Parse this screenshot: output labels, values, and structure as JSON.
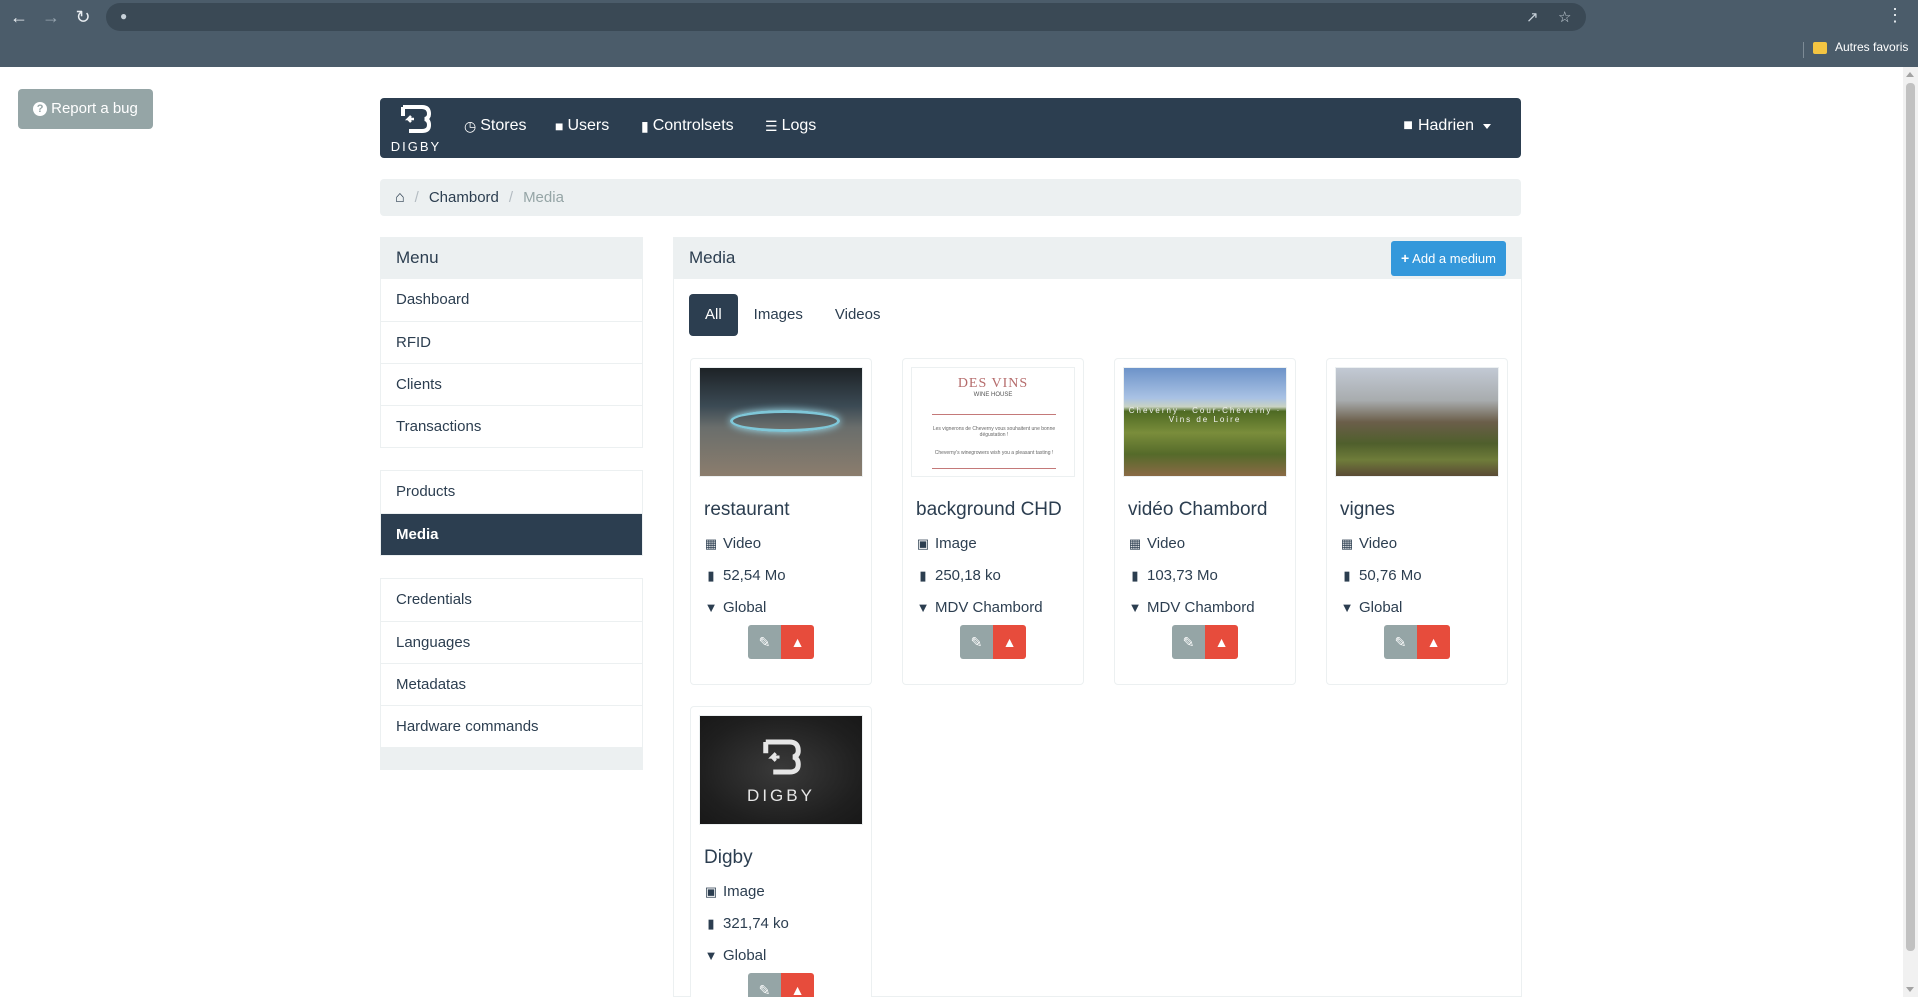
{
  "browser": {
    "bookmark_folder": "Autres favoris"
  },
  "report_bug": {
    "label": "Report a bug"
  },
  "navbar": {
    "brand": "DIGBY",
    "items": [
      {
        "label": "Stores",
        "icon": "dashboard-icon"
      },
      {
        "label": "Users",
        "icon": "user-icon"
      },
      {
        "label": "Controlsets",
        "icon": "signal-icon"
      },
      {
        "label": "Logs",
        "icon": "list-icon"
      }
    ],
    "user": "Hadrien"
  },
  "breadcrumb": {
    "items": [
      "Chambord",
      "Media"
    ]
  },
  "sidebar": {
    "title": "Menu",
    "group1": [
      "Dashboard",
      "RFID",
      "Clients",
      "Transactions"
    ],
    "group2": [
      "Products",
      "Media"
    ],
    "group3": [
      "Credentials",
      "Languages",
      "Metadatas",
      "Hardware commands"
    ],
    "active": "Media"
  },
  "media": {
    "title": "Media",
    "add_label": "Add a medium",
    "tabs": [
      "All",
      "Images",
      "Videos"
    ],
    "active_tab": "All",
    "cards": [
      {
        "title": "restaurant",
        "type": "Video",
        "size": "52,54 Mo",
        "store": "Global"
      },
      {
        "title": "background CHD",
        "type": "Image",
        "size": "250,18 ko",
        "store": "MDV Chambord"
      },
      {
        "title": "vidéo Chambord",
        "type": "Video",
        "size": "103,73 Mo",
        "store": "MDV Chambord"
      },
      {
        "title": "vignes",
        "type": "Video",
        "size": "50,76 Mo",
        "store": "Global"
      },
      {
        "title": "Digby",
        "type": "Image",
        "size": "321,74 ko",
        "store": "Global"
      }
    ],
    "thumb_texts": {
      "bg_heading": "DES VINS",
      "bg_sub": "WINE HOUSE",
      "bg_line1": "Les vignerons de Cheverny vous souhaitent une bonne dégustation !",
      "bg_line2": "Cheverny's winegrowers wish you a pleasant tasting !",
      "vine_band": "Cheverny · Cour-Cheverny · Vins de Loire",
      "digby_text": "DIGBY"
    }
  },
  "colors": {
    "primary": "#2c3e50",
    "info": "#3498db",
    "danger": "#e74c3c",
    "muted": "#95a5a6",
    "light": "#ecf0f1"
  }
}
